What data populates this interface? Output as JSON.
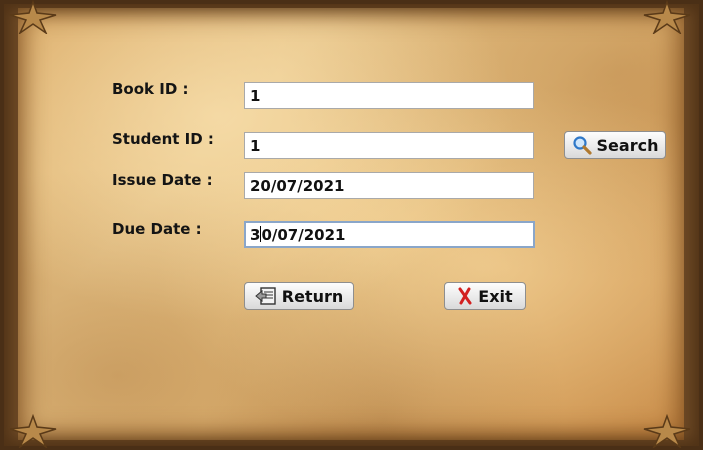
{
  "form": {
    "book_id_label": "Book ID :",
    "student_id_label": "Student ID :",
    "issue_date_label": "Issue Date :",
    "due_date_label": "Due Date :",
    "book_id_value": "1",
    "student_id_value": "1",
    "issue_date_value": "20/07/2021",
    "due_date_value_before_caret": "3",
    "due_date_value_after_caret": "0/07/2021"
  },
  "buttons": {
    "search_label": "Search",
    "return_label": "Return",
    "exit_label": "Exit"
  },
  "icons": {
    "search": "magnifier-icon",
    "return": "return-book-icon",
    "exit": "red-x-icon",
    "corners": "star-ornament-icon"
  },
  "colors": {
    "parchment": "#e3b774",
    "frame": "#6e4a26",
    "text": "#141414",
    "exit_icon": "#d32020",
    "search_icon": "#2f78c8"
  }
}
